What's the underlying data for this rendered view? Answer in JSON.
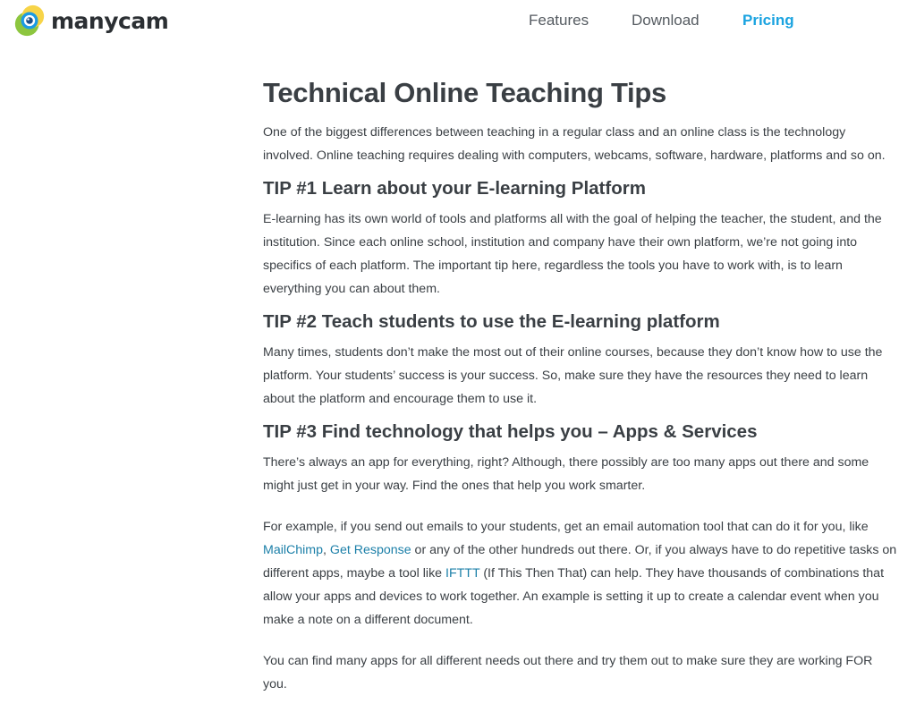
{
  "brand": {
    "name": "manycam"
  },
  "nav": [
    {
      "label": "Features",
      "active": false
    },
    {
      "label": "Download",
      "active": false
    },
    {
      "label": "Pricing",
      "active": true
    }
  ],
  "colors": {
    "accent": "#1aa3e0",
    "link": "#1b7fa8",
    "text": "#3b4045",
    "logo_green": "#8dc63f",
    "logo_yellow": "#f7d23e",
    "logo_blue": "#1c9be4"
  },
  "article": {
    "title": "Technical Online Teaching Tips",
    "intro": {
      "line1": "One of the biggest differences between teaching in a regular class and an online class is the technology",
      "line2": "involved. Online teaching requires dealing with computers, webcams, software, hardware, platforms and so on."
    },
    "tip1": {
      "heading": "TIP #1 Learn about your E-learning Platform",
      "line1": "E-learning has its own world of tools and platforms all with the goal of helping the teacher, the student, and the",
      "line2": "institution. Since each online school, institution and company have their own platform, we’re not going into",
      "line3": "specifics of each platform. The important tip here, regardless the tools you have to work with, is to learn",
      "line4": "everything you can about them."
    },
    "tip2": {
      "heading": "TIP #2 Teach students to use the E-learning platform",
      "line1": "Many times, students don’t make the most out of their online courses, because they don’t know how to use the",
      "line2": "platform. Your students’ success is your success. So, make sure they have the resources they need to learn",
      "line3": "about the platform and encourage them to use it."
    },
    "tip3": {
      "heading": "TIP #3 Find technology that helps you – Apps & Services",
      "p1": {
        "line1": "There’s always an app for everything, right? Although, there possibly are too many apps out there and some",
        "line2": "might just get in your way. Find the ones that help you work smarter."
      },
      "p2": {
        "line1": "For example, if you send out emails to your students, get an email automation tool that can do it for you, like",
        "link_mailchimp": "MailChimp",
        "comma": ", ",
        "link_getresponse": "Get Response",
        "line2_tail": " or any of the other hundreds out there. Or, if you always have to do repetitive tasks on",
        "line3_head": "different apps, maybe a tool like ",
        "link_ifttt": "IFTTT",
        "line3_tail": " (If This Then That) can help. They have thousands of combinations that",
        "line4": "allow your apps and devices to work together. An example is setting it up to create a calendar event when you",
        "line5": "make a note on a different document."
      },
      "p3": {
        "line1": "You can find many apps for all different needs out there and try them out to make sure they are working FOR",
        "line2": "you."
      }
    }
  }
}
